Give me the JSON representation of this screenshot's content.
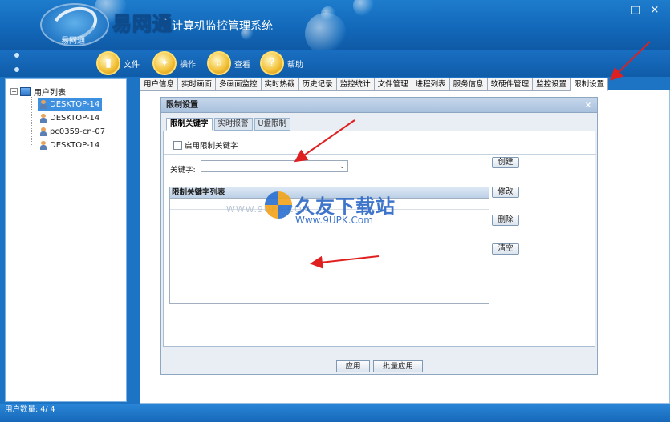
{
  "window": {
    "brand": "易网通",
    "subtitle": "计算机监控管理系统",
    "logo_text": "易网通",
    "minimize": "–",
    "maximize": "□",
    "close": "×"
  },
  "menu": [
    {
      "label": "文件",
      "icon": "folder-icon"
    },
    {
      "label": "操作",
      "icon": "tools-icon"
    },
    {
      "label": "查看",
      "icon": "magnifier-icon"
    },
    {
      "label": "帮助",
      "icon": "help-icon"
    }
  ],
  "sidebar": {
    "root": "用户列表",
    "items": [
      {
        "label": "DESKTOP-14",
        "selected": true
      },
      {
        "label": "DESKTOP-14",
        "selected": false
      },
      {
        "label": "pc0359-cn-07",
        "selected": false
      },
      {
        "label": "DESKTOP-14",
        "selected": false
      }
    ]
  },
  "tabs": [
    "用户信息",
    "实时画面",
    "多画面监控",
    "实时热截",
    "历史记录",
    "监控统计",
    "文件管理",
    "进程列表",
    "服务信息",
    "软硬件管理",
    "监控设置",
    "限制设置"
  ],
  "active_tab": "限制设置",
  "dialog": {
    "title": "限制设置",
    "close": "×",
    "tabs": [
      "限制关键字",
      "实时报警",
      "U盘限制"
    ],
    "enable_checkbox": "启用限制关键字",
    "keyword_label": "关键字:",
    "keyword_value": "",
    "buttons": {
      "create": "创建",
      "modify": "修改",
      "delete": "删除",
      "clear": "清空"
    },
    "list_header": "限制关键字列表",
    "apply": "应用",
    "batch_apply": "批量应用"
  },
  "watermark": {
    "title": "久友下载站",
    "sub": "Www.9UPK.Com",
    "faint": "WWW.9UPK.COM"
  },
  "status": "用户数量: 4/ 4",
  "colors": {
    "accent": "#1d73c4",
    "arrow": "#e02020"
  }
}
